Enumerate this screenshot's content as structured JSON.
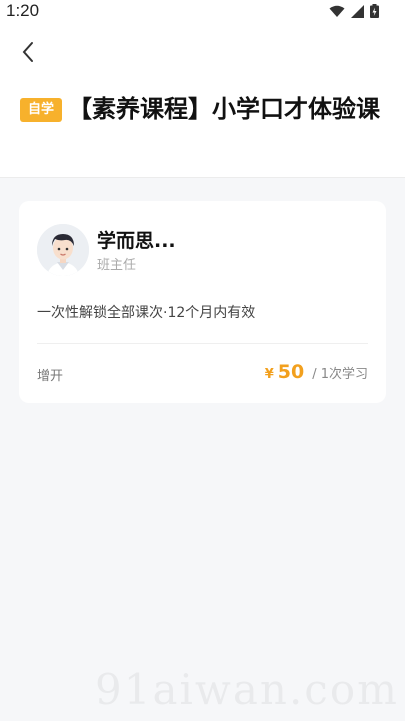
{
  "status_bar": {
    "time": "1:20"
  },
  "header": {
    "back_icon": "chevron-left-icon",
    "tag": "自学",
    "title": "【素养课程】小学口才体验课"
  },
  "card": {
    "teacher": {
      "name": "学而思...",
      "role": "班主任"
    },
    "description": "一次性解锁全部课次·12个月内有效",
    "left_label": "增开",
    "price": {
      "symbol": "¥",
      "value": "50",
      "unit": "/ 1次学习"
    }
  },
  "watermark": "91aiwan.com",
  "colors": {
    "accent": "#f7b12c",
    "price": "#f2a01e",
    "background": "#f6f7f9"
  }
}
